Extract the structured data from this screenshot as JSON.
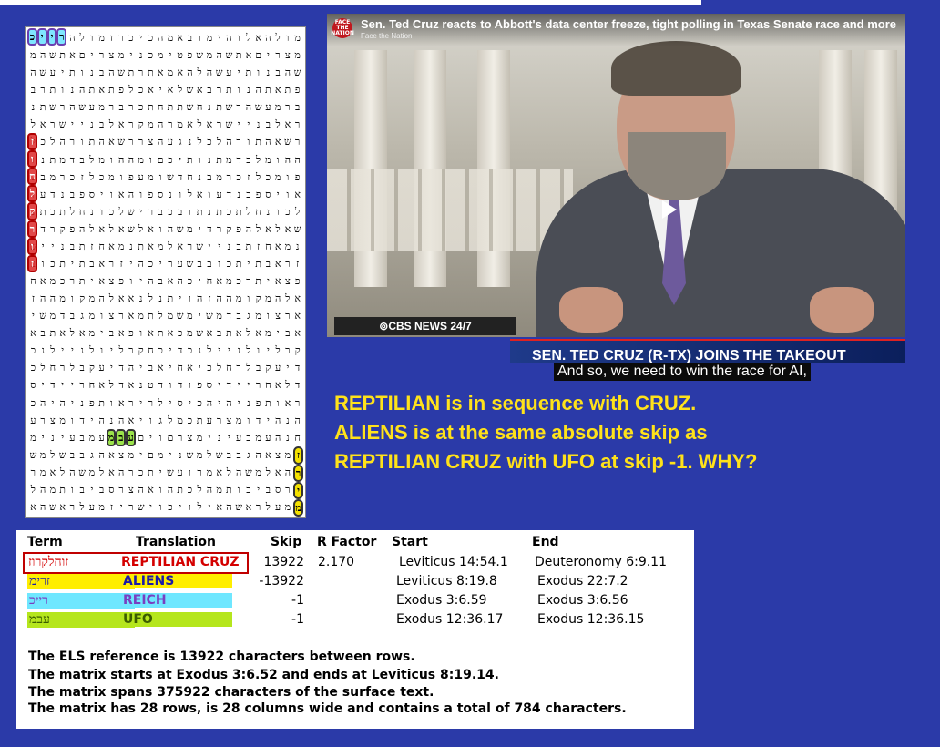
{
  "matrix": {
    "rows": [
      "מולהאלוהימובאמהכיכרז",
      "מצריםאתשהמשפטימכני",
      "שהבנותיעשהלהאמאתרת",
      "פתאתהנותרבאשלאיאכל",
      "ברמעשהרשתנחשתתחתכר",
      "ראלבניישראלאמרהמק",
      "רשאהתורהלכלנגעהצר",
      "ההומלבדמתנותיכםומ",
      "פומכלזכרמבנחדשומע",
      "אויספבנדעואלונספוה",
      "לכונחלתכתנתובכבריש",
      "שאלאלהפקרדימשהואל",
      "נמאחזתבניישראלמאת",
      "זראבתיתכובבשעריכהי",
      "פצאיתרכמאחיכהאבהיו",
      "אלהמקומההזהויתנלנא",
      "ארצומגבדמשימשמלתמ",
      "אבימאלאתבאשמכאתאופ",
      "קרליולניילנכדיכח",
      "דיעקבלרחלכיאחיאביה",
      "דלאחריידיספודודטנא",
      "ראותפניהיהכיסילרי",
      "הנהידומצרעתכמלגויא",
      "חנהעמבעינימצרםוים",
      "ימצאהגבבשלמשנימם",
      "רהאלמשהלאמרועשיתכ",
      "צרסביבותמהלכתהואה",
      "זמעלראשהאילויכוישרי"
    ],
    "highlights": {
      "reptilian_cruz": [
        "ז",
        "ו",
        "ח",
        "ל",
        "ק",
        "ר",
        "ו",
        "ז"
      ],
      "aliens": [
        "ז",
        "ר",
        "י",
        "מ"
      ],
      "reich": [
        "ר",
        "י",
        "י",
        "כ"
      ],
      "ufo": [
        "ע",
        "ב",
        "מ"
      ]
    }
  },
  "video": {
    "title": "Sen. Ted Cruz reacts to Abbott's data center freeze, tight polling in Texas Senate race and more",
    "channel": "Face the Nation",
    "logo_text": "FACE THE NATION",
    "network_badge": "⊚CBS NEWS 24/7",
    "lower_third": "SEN. TED CRUZ (R-TX) JOINS THE TAKEOUT",
    "caption": "And so, we need to win the race for AI,"
  },
  "comment": {
    "line1": "REPTILIAN is in sequence with CRUZ.",
    "line2": "ALIENS is at the same absolute skip as",
    "line3": "REPTILIAN CRUZ with UFO at skip -1. WHY?"
  },
  "table": {
    "headers": {
      "term": "Term",
      "translation": "Translation",
      "skip": "Skip",
      "rfactor": "R Factor",
      "start": "Start",
      "end": "End"
    },
    "rows": [
      {
        "term": "זוחלקרוז",
        "translation": "REPTILIAN CRUZ",
        "skip": "13922",
        "rfactor": "2.170",
        "start": "Leviticus 14:54.1",
        "end": "Deuteronomy 6:9.11",
        "color": "#d40000",
        "bg": "#ffffff"
      },
      {
        "term": "זרימ",
        "translation": "ALIENS",
        "skip": "-13922",
        "rfactor": "",
        "start": "Leviticus 8:19.8",
        "end": "Exodus 22:7.2",
        "color": "#1a1aa8",
        "bg": "#ffee00"
      },
      {
        "term": "רייכ",
        "translation": "REICH",
        "skip": "-1",
        "rfactor": "",
        "start": "Exodus 3:6.59",
        "end": "Exodus 3:6.56",
        "color": "#7a3fc0",
        "bg": "#6fe7ff"
      },
      {
        "term": "עבמ",
        "translation": "UFO",
        "skip": "-1",
        "rfactor": "",
        "start": "Exodus 12:36.17",
        "end": "Exodus 12:36.15",
        "color": "#3b5d00",
        "bg": "#b5e61d"
      }
    ],
    "footer": [
      "The ELS reference is 13922 characters between rows.",
      "The matrix starts at Exodus 3:6.52 and ends at Leviticus 8:19.14.",
      "The matrix spans 375922 characters of the surface text.",
      "The matrix has 28 rows, is 28 columns wide and contains a total of 784 characters."
    ]
  },
  "colors": {
    "background": "#2b3aa8",
    "comment": "#ffe21a",
    "red_highlight": "#d40000"
  }
}
